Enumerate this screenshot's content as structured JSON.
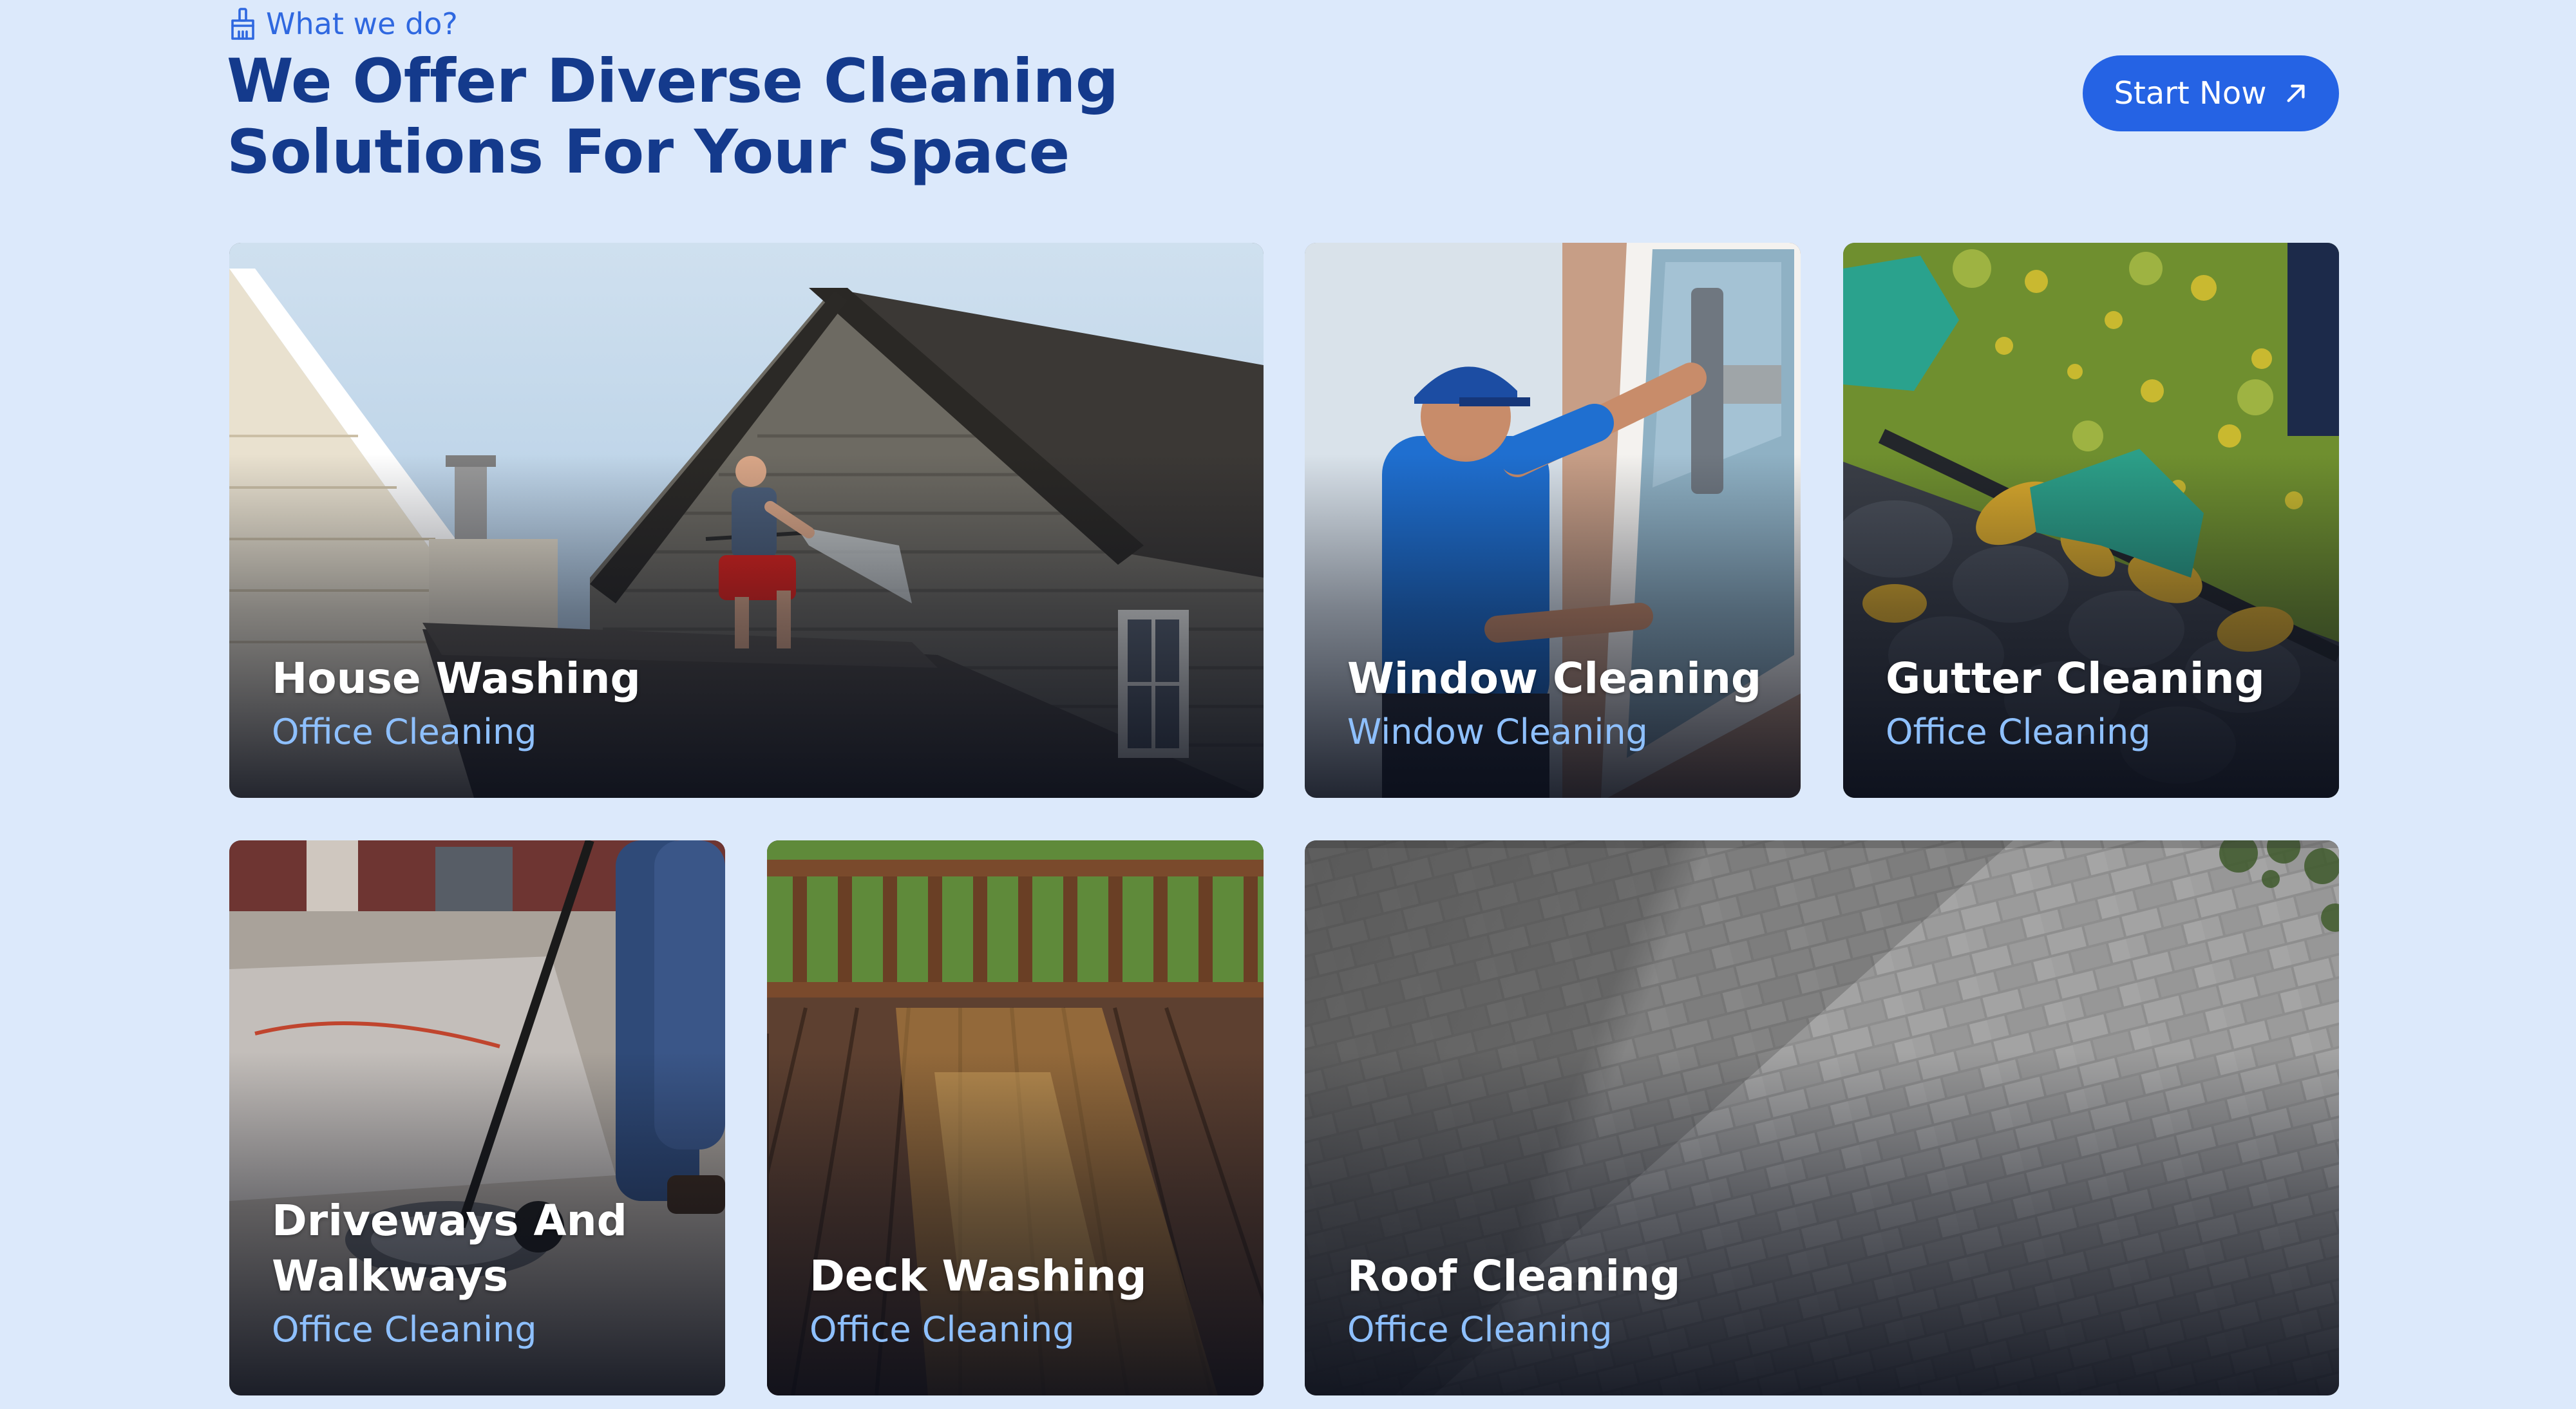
{
  "header": {
    "eyebrow": "What we do?",
    "eyebrow_icon": "broom-icon",
    "title_line1": "We Offer Diverse Cleaning",
    "title_line2": "Solutions For Your Space",
    "cta_label": "Start Now",
    "cta_icon": "arrow-up-right-icon"
  },
  "services": [
    {
      "title": "House Washing",
      "subtitle": "Office Cleaning"
    },
    {
      "title": "Window Cleaning",
      "subtitle": "Window Cleaning"
    },
    {
      "title": "Gutter Cleaning",
      "subtitle": "Office Cleaning"
    },
    {
      "title_line1": "Driveways And",
      "title_line2": "Walkways",
      "subtitle": "Office Cleaning"
    },
    {
      "title": "Deck Washing",
      "subtitle": "Office Cleaning"
    },
    {
      "title": "Roof Cleaning",
      "subtitle": "Office Cleaning"
    }
  ],
  "colors": {
    "background": "#dce9fb",
    "heading": "#143a8c",
    "accent": "#2563e4",
    "subtitle": "#8ec0ff"
  }
}
